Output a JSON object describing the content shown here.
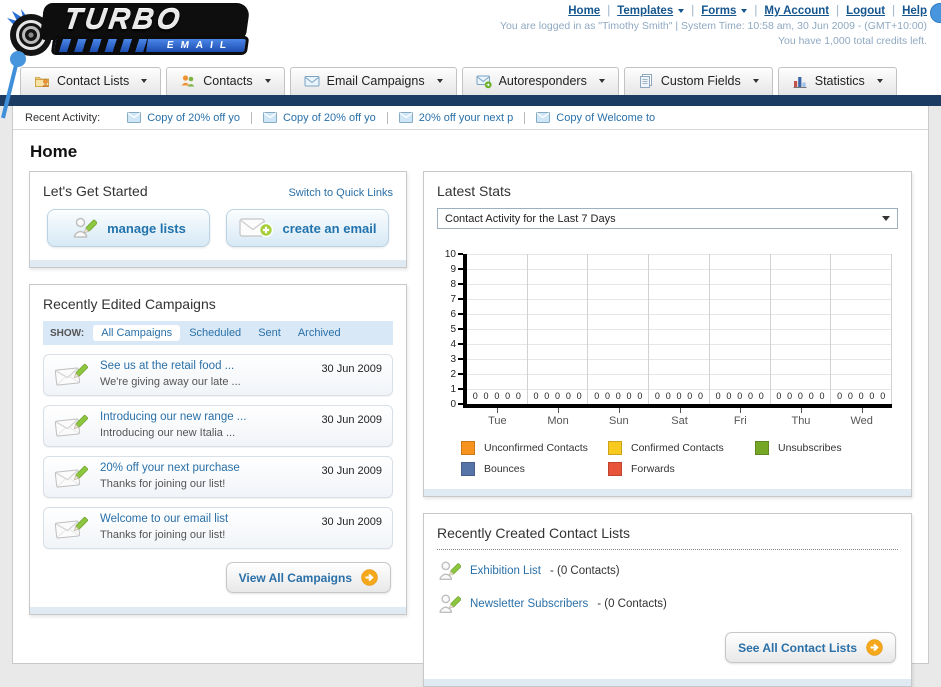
{
  "brand": {
    "name_top": "TURBO",
    "name_bottom": "EMAIL"
  },
  "top_nav": {
    "links": [
      {
        "label": "Home",
        "dropdown": false
      },
      {
        "label": "Templates",
        "dropdown": true
      },
      {
        "label": "Forms",
        "dropdown": true
      },
      {
        "label": "My Account",
        "dropdown": false
      },
      {
        "label": "Logout",
        "dropdown": false
      },
      {
        "label": "Help",
        "dropdown": false
      }
    ],
    "login_line": "You are logged in as \"Timothy Smith\" | System Time: 10:58 am, 30 Jun 2009 - (GMT+10:00)",
    "credits_line": "You have 1,000 total credits left."
  },
  "main_tabs": [
    {
      "label": "Contact Lists",
      "icon": "contact-lists"
    },
    {
      "label": "Contacts",
      "icon": "contacts"
    },
    {
      "label": "Email Campaigns",
      "icon": "email-campaigns"
    },
    {
      "label": "Autoresponders",
      "icon": "autoresponders"
    },
    {
      "label": "Custom Fields",
      "icon": "custom-fields"
    },
    {
      "label": "Statistics",
      "icon": "statistics"
    }
  ],
  "recent_activity": {
    "label": "Recent Activity:",
    "items": [
      "Copy of 20% off yo",
      "Copy of 20% off yo",
      "20% off your next p",
      "Copy of Welcome to"
    ]
  },
  "page_title": "Home",
  "get_started": {
    "title": "Let's Get Started",
    "switch_link": "Switch to Quick Links",
    "manage_lists_label": "manage lists",
    "create_email_label": "create an email"
  },
  "campaigns": {
    "title": "Recently Edited Campaigns",
    "show_label": "SHOW:",
    "active_filter": "All Campaigns",
    "filters": [
      "All Campaigns",
      "Scheduled",
      "Sent",
      "Archived"
    ],
    "items": [
      {
        "title": "See us at the retail food ...",
        "subtitle": "We're giving away our late ...",
        "date": "30 Jun 2009"
      },
      {
        "title": "Introducing our new range ...",
        "subtitle": "Introducing our new Italia ...",
        "date": "30 Jun 2009"
      },
      {
        "title": "20% off your next purchase",
        "subtitle": "Thanks for joining our list!",
        "date": "30 Jun 2009"
      },
      {
        "title": "Welcome to our email list",
        "subtitle": "Thanks for joining our list!",
        "date": "30 Jun 2009"
      }
    ],
    "view_all_label": "View All Campaigns"
  },
  "latest_stats": {
    "title": "Latest Stats",
    "selected_option": "Contact Activity for the Last 7 Days"
  },
  "chart_data": {
    "type": "bar",
    "title": "Contact Activity for the Last 7 Days",
    "categories": [
      "Tue",
      "Mon",
      "Sun",
      "Sat",
      "Fri",
      "Thu",
      "Wed"
    ],
    "series": [
      {
        "name": "Unconfirmed Contacts",
        "color": "#f6921e",
        "values": [
          0,
          0,
          0,
          0,
          0,
          0,
          0
        ]
      },
      {
        "name": "Confirmed Contacts",
        "color": "#f8c91f",
        "values": [
          0,
          0,
          0,
          0,
          0,
          0,
          0
        ]
      },
      {
        "name": "Unsubscribes",
        "color": "#76a625",
        "values": [
          0,
          0,
          0,
          0,
          0,
          0,
          0
        ]
      },
      {
        "name": "Bounces",
        "color": "#5674a7",
        "values": [
          0,
          0,
          0,
          0,
          0,
          0,
          0
        ]
      },
      {
        "name": "Forwards",
        "color": "#e8543a",
        "values": [
          0,
          0,
          0,
          0,
          0,
          0,
          0
        ]
      }
    ],
    "ylim": [
      0,
      10
    ],
    "yticks": [
      0,
      1,
      2,
      3,
      4,
      5,
      6,
      7,
      8,
      9,
      10
    ],
    "grid": true,
    "legend_position": "bottom"
  },
  "contact_lists": {
    "title": "Recently Created Contact Lists",
    "items": [
      {
        "name": "Exhibition List",
        "meta": "- (0 Contacts)"
      },
      {
        "name": "Newsletter Subscribers",
        "meta": "- (0 Contacts)"
      }
    ],
    "see_all_label": "See All Contact Lists"
  }
}
